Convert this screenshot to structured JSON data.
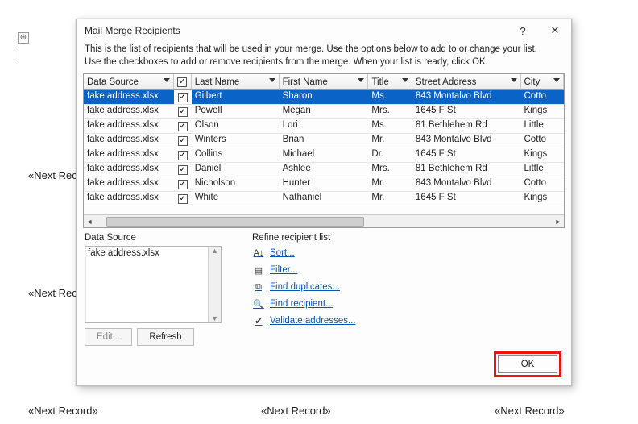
{
  "bg": {
    "field": "«Next Record»",
    "anchor_glyph": "⊕"
  },
  "dialog": {
    "title": "Mail Merge Recipients",
    "help_glyph": "?",
    "close_glyph": "✕",
    "desc_line1": "This is the list of recipients that will be used in your merge.  Use the options below to add to or change your list.",
    "desc_line2": "Use the checkboxes to add or remove recipients from the merge.  When your list is ready, click OK.",
    "columns": {
      "data_source": "Data Source",
      "last_name": "Last Name",
      "first_name": "First Name",
      "title": "Title",
      "street": "Street Address",
      "city": "City"
    },
    "header_check_glyph": "✓",
    "rows": [
      {
        "ds": "fake address.xlsx",
        "checked": true,
        "ln": "Gilbert",
        "fn": "Sharon",
        "ti": "Ms.",
        "sa": "843 Montalvo Blvd",
        "ci": "Cotto"
      },
      {
        "ds": "fake address.xlsx",
        "checked": true,
        "ln": "Powell",
        "fn": "Megan",
        "ti": "Mrs.",
        "sa": "1645 F St",
        "ci": "Kings"
      },
      {
        "ds": "fake address.xlsx",
        "checked": true,
        "ln": "Olson",
        "fn": "Lori",
        "ti": "Ms.",
        "sa": "81 Bethlehem Rd",
        "ci": "Little"
      },
      {
        "ds": "fake address.xlsx",
        "checked": true,
        "ln": "Winters",
        "fn": "Brian",
        "ti": "Mr.",
        "sa": "843 Montalvo Blvd",
        "ci": "Cotto"
      },
      {
        "ds": "fake address.xlsx",
        "checked": true,
        "ln": "Collins",
        "fn": "Michael",
        "ti": "Dr.",
        "sa": "1645 F St",
        "ci": "Kings"
      },
      {
        "ds": "fake address.xlsx",
        "checked": true,
        "ln": "Daniel",
        "fn": "Ashlee",
        "ti": "Mrs.",
        "sa": "81 Bethlehem Rd",
        "ci": "Little"
      },
      {
        "ds": "fake address.xlsx",
        "checked": true,
        "ln": "Nicholson",
        "fn": "Hunter",
        "ti": "Mr.",
        "sa": "843 Montalvo Blvd",
        "ci": "Cotto"
      },
      {
        "ds": "fake address.xlsx",
        "checked": true,
        "ln": "White",
        "fn": "Nathaniel",
        "ti": "Mr.",
        "sa": "1645 F St",
        "ci": "Kings"
      }
    ],
    "data_source": {
      "label": "Data Source",
      "items": [
        "fake address.xlsx"
      ],
      "edit_label": "Edit...",
      "refresh_label": "Refresh"
    },
    "refine": {
      "label": "Refine recipient list",
      "sort": "Sort...",
      "filter": "Filter...",
      "dupes": "Find duplicates...",
      "find": "Find recipient...",
      "validate": "Validate addresses..."
    },
    "ok_label": "OK"
  }
}
